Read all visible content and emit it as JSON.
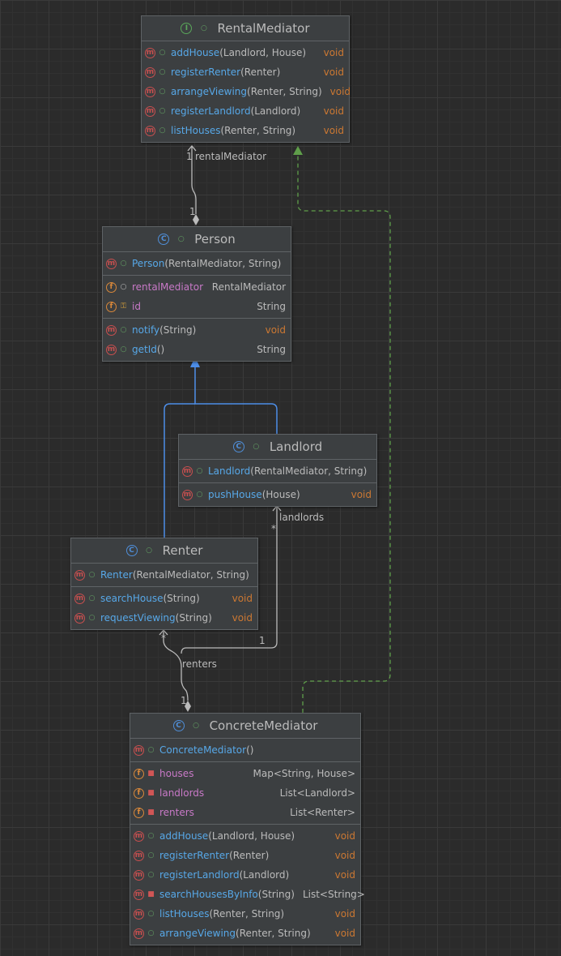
{
  "classes": {
    "rental_mediator": {
      "name": "RentalMediator",
      "kind_glyph": "I",
      "methods": [
        {
          "name": "addHouse",
          "params": "(Landlord, House)",
          "returns": "void"
        },
        {
          "name": "registerRenter",
          "params": "(Renter)",
          "returns": "void"
        },
        {
          "name": "arrangeViewing",
          "params": "(Renter, String)",
          "returns": "void"
        },
        {
          "name": "registerLandlord",
          "params": "(Landlord)",
          "returns": "void"
        },
        {
          "name": "listHouses",
          "params": "(Renter, String)",
          "returns": "void"
        }
      ]
    },
    "person": {
      "name": "Person",
      "kind_glyph": "C",
      "constructors": [
        {
          "name": "Person",
          "params": "(RentalMediator, String)"
        }
      ],
      "fields": [
        {
          "name": "rentalMediator",
          "type": "RentalMediator"
        },
        {
          "name": "id",
          "type": "String"
        }
      ],
      "methods": [
        {
          "name": "notify",
          "params": "(String)",
          "returns": "void"
        },
        {
          "name": "getId",
          "params": "()",
          "returns": "String"
        }
      ]
    },
    "landlord": {
      "name": "Landlord",
      "kind_glyph": "C",
      "constructors": [
        {
          "name": "Landlord",
          "params": "(RentalMediator, String)"
        }
      ],
      "methods": [
        {
          "name": "pushHouse",
          "params": "(House)",
          "returns": "void"
        }
      ]
    },
    "renter": {
      "name": "Renter",
      "kind_glyph": "C",
      "constructors": [
        {
          "name": "Renter",
          "params": "(RentalMediator, String)"
        }
      ],
      "methods": [
        {
          "name": "searchHouse",
          "params": "(String)",
          "returns": "void"
        },
        {
          "name": "requestViewing",
          "params": "(String)",
          "returns": "void"
        }
      ]
    },
    "concrete_mediator": {
      "name": "ConcreteMediator",
      "kind_glyph": "C",
      "constructors": [
        {
          "name": "ConcreteMediator",
          "params": "()"
        }
      ],
      "fields": [
        {
          "name": "houses",
          "type": "Map<String, House>"
        },
        {
          "name": "landlords",
          "type": "List<Landlord>"
        },
        {
          "name": "renters",
          "type": "List<Renter>"
        }
      ],
      "methods": [
        {
          "name": "addHouse",
          "params": "(Landlord, House)",
          "returns": "void"
        },
        {
          "name": "registerRenter",
          "params": "(Renter)",
          "returns": "void"
        },
        {
          "name": "registerLandlord",
          "params": "(Landlord)",
          "returns": "void"
        },
        {
          "name": "searchHousesByInfo",
          "params": "(String)",
          "returns": "List<String>"
        },
        {
          "name": "listHouses",
          "params": "(Renter, String)",
          "returns": "void"
        },
        {
          "name": "arrangeViewing",
          "params": "(Renter, String)",
          "returns": "void"
        }
      ]
    }
  },
  "edge_labels": {
    "mediator_multiplicity": "1",
    "mediator_role": "rentalMediator",
    "person_multiplicity": "1",
    "landlords_role": "landlords",
    "landlords_multiplicity": "*",
    "landlords_owner_multiplicity": "1",
    "renters_role": "renters",
    "renters_multiplicity": "*",
    "renters_owner_multiplicity": "1"
  },
  "glyphs": {
    "method": "m",
    "field": "f",
    "public": "←",
    "icons": {
      "method": "method-icon",
      "field": "field-icon",
      "class": "class-icon",
      "interface": "interface-icon",
      "public": "public-visibility-icon",
      "private": "private-lock-icon",
      "package": "package-visibility-icon",
      "protected": "protected-key-icon"
    }
  },
  "colors": {
    "background": "#2b2b2b",
    "box": "#3c3f41",
    "method_name": "#57a8e8",
    "field_name": "#c879c7",
    "void_type": "#cc7832",
    "inheritance_edge": "#4d8ee8",
    "realization_edge": "#5f9e4a",
    "association_edge": "#bbbbbb"
  }
}
